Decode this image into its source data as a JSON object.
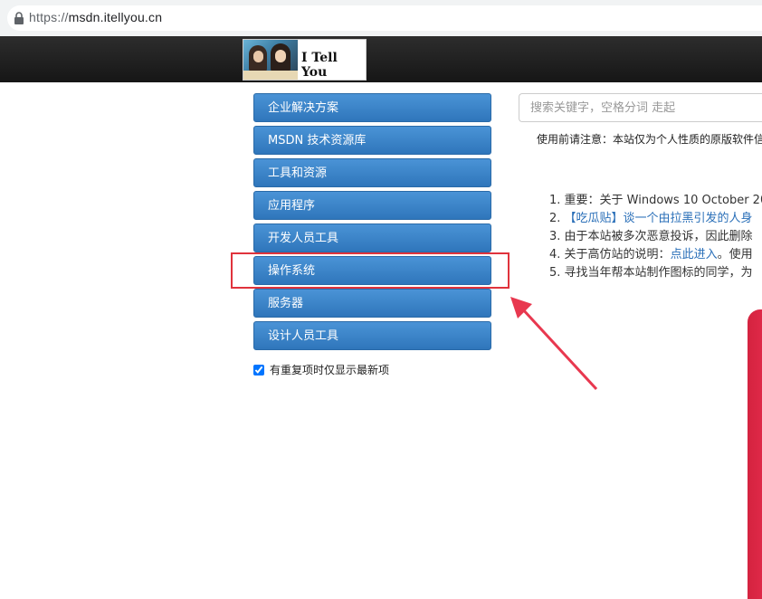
{
  "browser": {
    "url_scheme": "https://",
    "url_host": "msdn.itellyou.cn"
  },
  "header": {
    "logo_text": "I Tell You"
  },
  "menu": {
    "items": [
      {
        "label": "企业解决方案"
      },
      {
        "label": "MSDN 技术资源库"
      },
      {
        "label": "工具和资源"
      },
      {
        "label": "应用程序"
      },
      {
        "label": "开发人员工具"
      },
      {
        "label": "操作系统"
      },
      {
        "label": "服务器"
      },
      {
        "label": "设计人员工具"
      }
    ],
    "dedupe_label": "有重复项时仅显示最新项",
    "dedupe_checked": true
  },
  "search": {
    "placeholder": "搜索关键字，空格分词 走起"
  },
  "notice": "使用前请注意：本站仅为个人性质的原版软件信",
  "news": [
    {
      "num": "1.",
      "text": "重要：关于 Windows 10 October 20",
      "link": ""
    },
    {
      "num": "2.",
      "text": "",
      "link": "【吃瓜贴】谈一个由拉黑引发的人身"
    },
    {
      "num": "3.",
      "text": "由于本站被多次恶意投诉，因此删除",
      "link": ""
    },
    {
      "num": "4.",
      "text": "关于高仿站的说明：",
      "link": "点此进入",
      "suffix": "。使用"
    },
    {
      "num": "5.",
      "text": "寻找当年帮本站制作图标的同学，为",
      "link": ""
    }
  ],
  "colors": {
    "menu_button": "#3a84c8",
    "highlight": "#e0333c",
    "link": "#2a6fb8",
    "banner": "#d4233f"
  }
}
